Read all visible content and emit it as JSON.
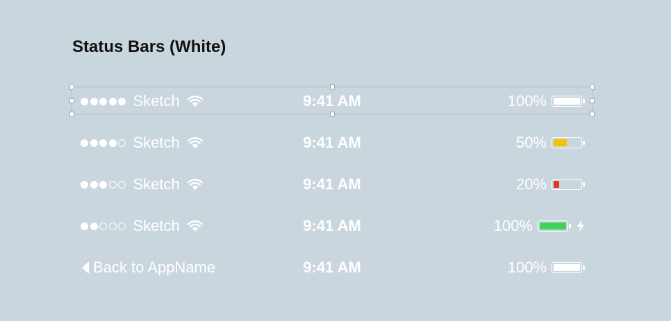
{
  "title": "Status Bars (White)",
  "colors": {
    "background": "#cad6dd",
    "battery_full": "#ffffff",
    "battery_half": "#f4c400",
    "battery_low": "#e6332a",
    "battery_charging": "#3dd25c"
  },
  "rows": [
    {
      "signal": [
        true,
        true,
        true,
        true,
        true
      ],
      "carrier": "Sketch",
      "icon": "wifi-icon",
      "time": "9:41 AM",
      "battery_pct": "100%",
      "battery_level": 1.0,
      "battery_color": "#ffffff",
      "charging": false
    },
    {
      "signal": [
        true,
        true,
        true,
        true,
        false
      ],
      "carrier": "Sketch",
      "icon": "wifi-icon",
      "time": "9:41 AM",
      "battery_pct": "50%",
      "battery_level": 0.5,
      "battery_color": "#f4c400",
      "charging": false
    },
    {
      "signal": [
        true,
        true,
        true,
        false,
        false
      ],
      "carrier": "Sketch",
      "icon": "wifi-icon",
      "time": "9:41 AM",
      "battery_pct": "20%",
      "battery_level": 0.2,
      "battery_color": "#e6332a",
      "charging": false
    },
    {
      "signal": [
        true,
        true,
        false,
        false,
        false
      ],
      "carrier": "Sketch",
      "icon": "wifi-icon",
      "time": "9:41 AM",
      "battery_pct": "100%",
      "battery_level": 1.0,
      "battery_color": "#3dd25c",
      "charging": true
    },
    {
      "back_label": "Back to AppName",
      "icon": "back-arrow-icon",
      "time": "9:41 AM",
      "battery_pct": "100%",
      "battery_level": 1.0,
      "battery_color": "#ffffff",
      "charging": false
    }
  ]
}
